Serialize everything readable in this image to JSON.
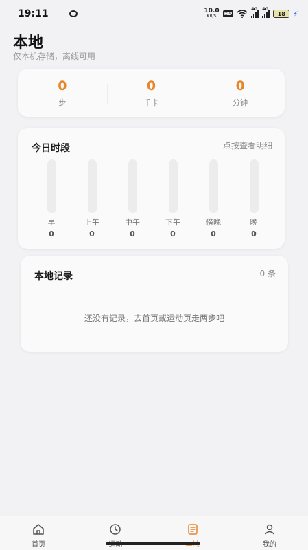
{
  "status_bar": {
    "time": "19:11",
    "net_speed": "10.0",
    "net_speed_unit": "KB/S",
    "hd_label": "HD",
    "signal1_label": "4G",
    "signal2_label": "4G",
    "battery": "18"
  },
  "header": {
    "title": "本地",
    "subtitle": "仅本机存储，离线可用"
  },
  "summary": {
    "items": [
      {
        "value": "0",
        "label": "步"
      },
      {
        "value": "0",
        "label": "千卡"
      },
      {
        "value": "0",
        "label": "分钟"
      }
    ]
  },
  "periods": {
    "title": "今日时段",
    "hint": "点按查看明细",
    "items": [
      {
        "label": "早",
        "value": "0",
        "level": 0
      },
      {
        "label": "上午",
        "value": "0",
        "level": 0
      },
      {
        "label": "中午",
        "value": "0",
        "level": 0
      },
      {
        "label": "下午",
        "value": "0",
        "level": 0
      },
      {
        "label": "傍晚",
        "value": "0",
        "level": 0
      },
      {
        "label": "晚",
        "value": "0",
        "level": 0
      }
    ]
  },
  "records": {
    "title": "本地记录",
    "count": "0 条",
    "empty_text": "还没有记录，去首页或运动页走两步吧"
  },
  "nav": {
    "items": [
      {
        "label": "首页",
        "icon": "home-icon"
      },
      {
        "label": "运动",
        "icon": "clock-icon"
      },
      {
        "label": "本地",
        "icon": "document-icon"
      },
      {
        "label": "我的",
        "icon": "person-icon"
      }
    ],
    "active_index": 2
  },
  "colors": {
    "accent": "#e8862a",
    "background": "#f2f2f4",
    "card": "#fafafa"
  }
}
